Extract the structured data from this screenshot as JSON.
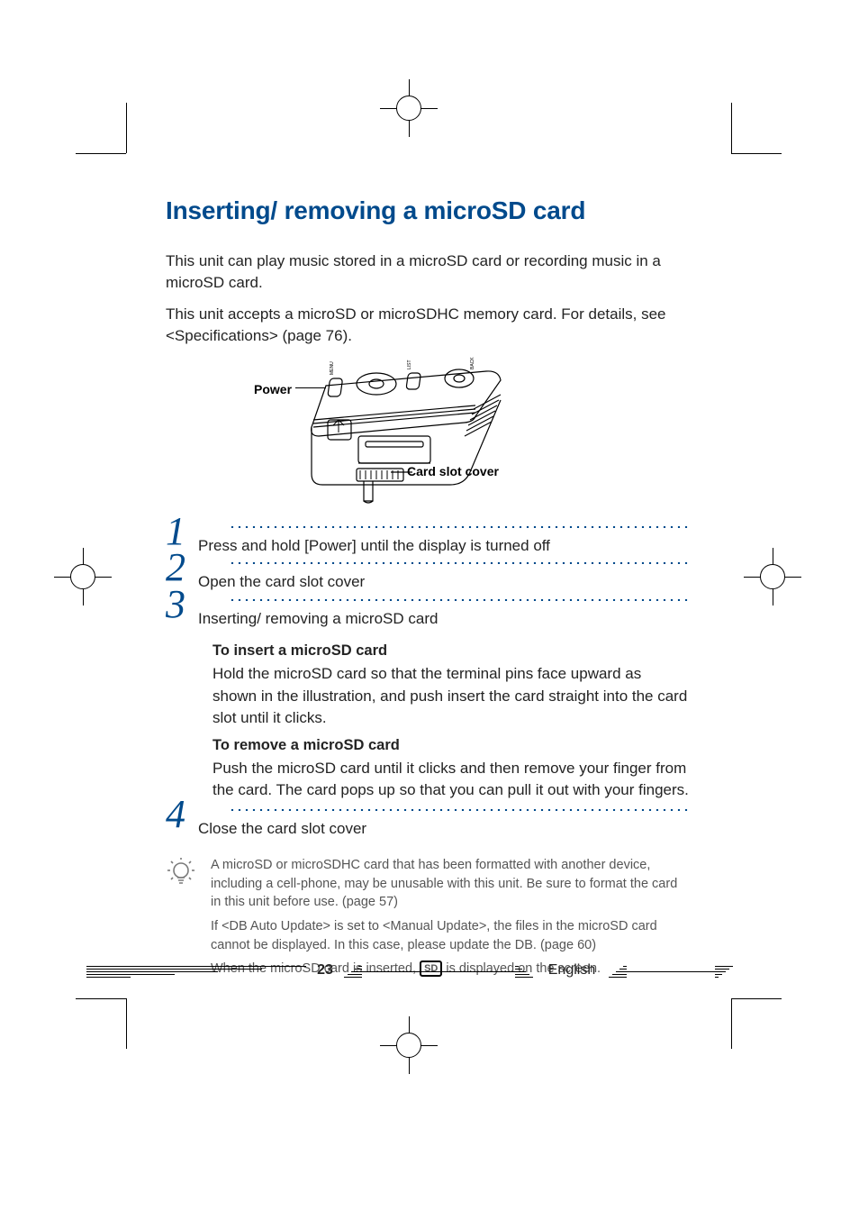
{
  "title": "Inserting/ removing a microSD card",
  "intro": {
    "p1": "This unit can play music stored in a microSD card or recording music in a microSD card.",
    "p2": "This unit accepts a microSD or microSDHC memory card. For details, see <Specifications> (page 76)."
  },
  "figure": {
    "power_label": "Power",
    "card_slot_cover_label": "Card slot cover"
  },
  "steps": [
    {
      "num": "1",
      "text": "Press and hold [Power] until the display is turned off"
    },
    {
      "num": "2",
      "text": "Open the card slot cover"
    },
    {
      "num": "3",
      "text": "Inserting/ removing a microSD card",
      "blocks": [
        {
          "head": "To insert a microSD card",
          "body": "Hold the microSD card so that the terminal pins face upward as shown in the illustration, and push insert the card straight into the card slot until it clicks."
        },
        {
          "head": "To remove a microSD card",
          "body": "Push the microSD card until it clicks and then remove your finger from the card. The card pops up so that you can pull it out with your fingers."
        }
      ]
    },
    {
      "num": "4",
      "text": "Close the card slot cover"
    }
  ],
  "tips": {
    "t1": "A microSD or microSDHC card that has been formatted with another device, including a cell-phone, may be unusable with this unit. Be sure to format the card in this unit before use. (page 57)",
    "t2": "If <DB Auto Update> is set to <Manual Update>, the files in the microSD card cannot be displayed. In this case, please update the DB. (page 60)",
    "t3_pre": "When the microSD card is inserted, ",
    "t3_badge": "SD",
    "t3_post": " is displayed on the screen."
  },
  "footer": {
    "page_number": "23",
    "language": "English"
  }
}
